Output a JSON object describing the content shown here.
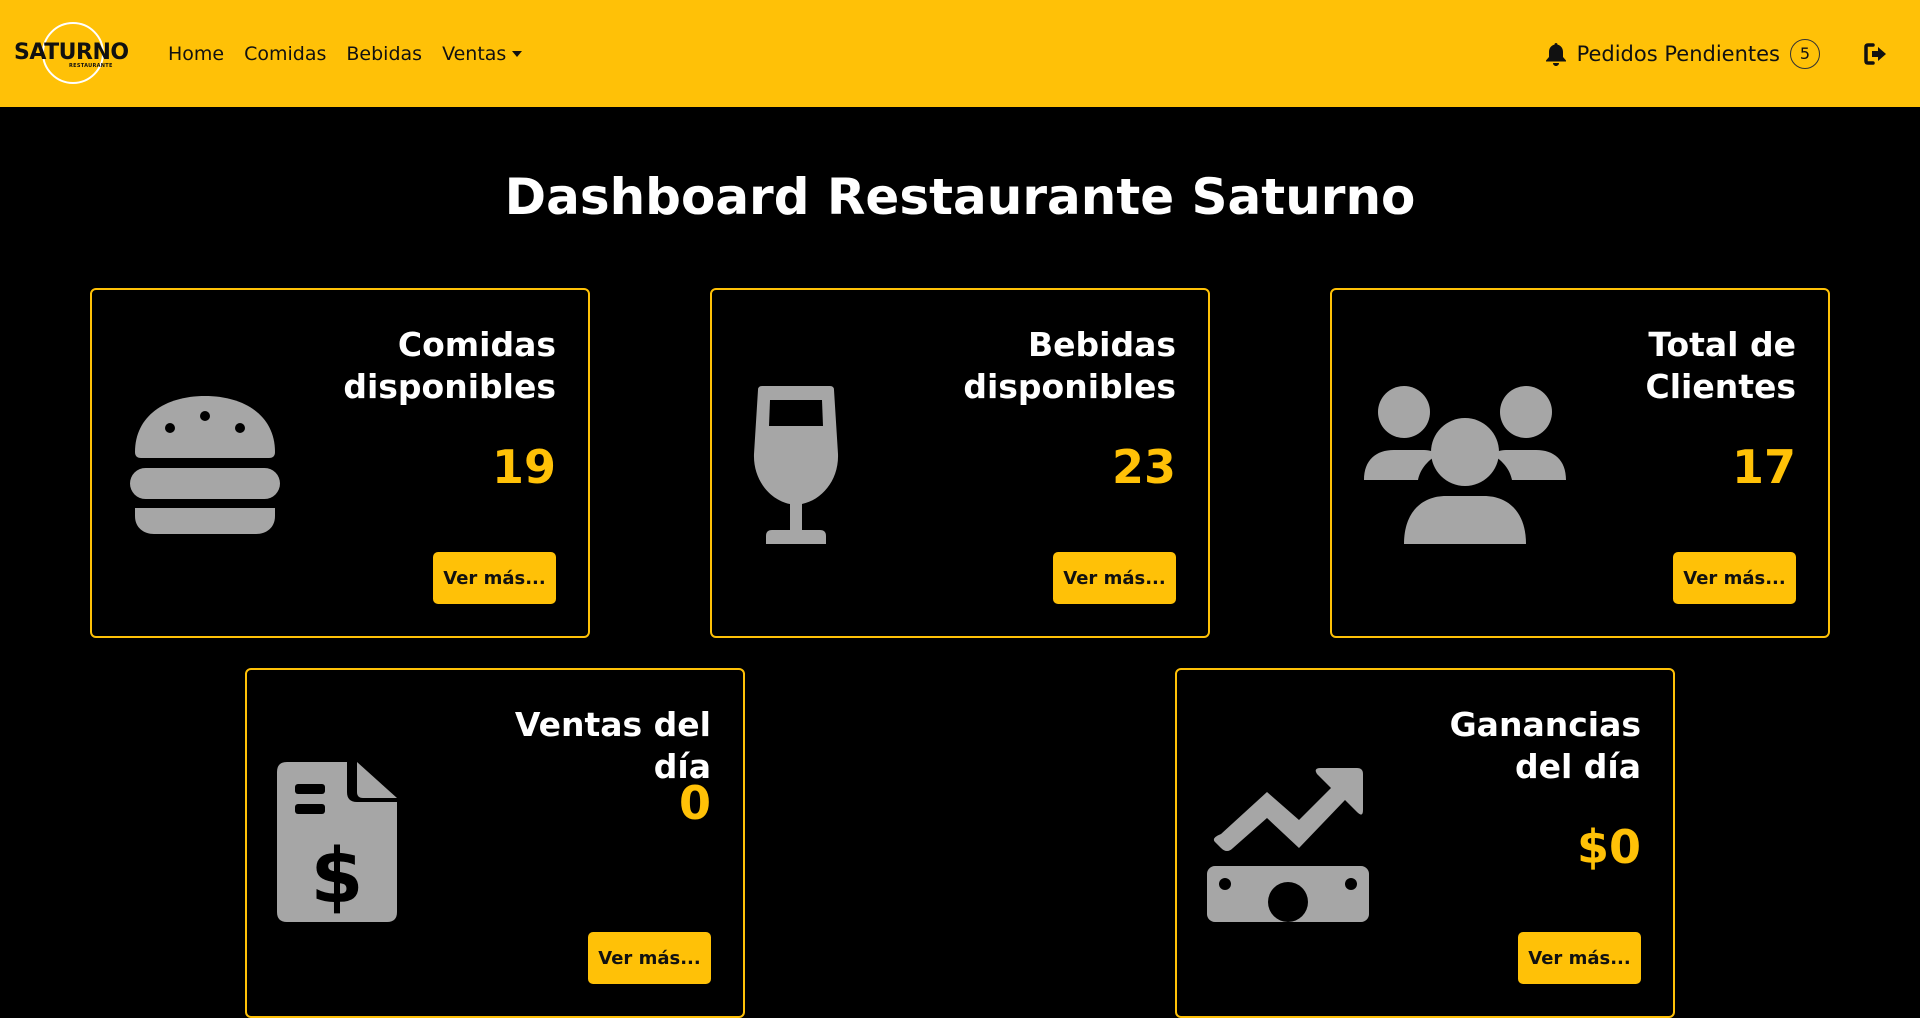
{
  "brand": {
    "name": "SATURNO",
    "sub": "RESTAURANTE"
  },
  "nav": {
    "links": [
      "Home",
      "Comidas",
      "Bebidas",
      "Ventas"
    ],
    "pending_label": "Pedidos Pendientes",
    "pending_count": "5"
  },
  "page_title": "Dashboard Restaurante Saturno",
  "cards": [
    {
      "label": "Comidas disponibles",
      "value": "19",
      "button": "Ver más...",
      "icon": "hamburger-icon"
    },
    {
      "label": "Bebidas disponibles",
      "value": "23",
      "button": "Ver más...",
      "icon": "wine-glass-icon"
    },
    {
      "label": "Total de Clientes",
      "value": "17",
      "button": "Ver más...",
      "icon": "users-icon"
    },
    {
      "label": "Ventas del día",
      "value": "0",
      "button": "Ver más...",
      "icon": "invoice-dollar-icon"
    },
    {
      "label": "Ganancias del día",
      "value": "$0",
      "button": "Ver más...",
      "icon": "money-trend-icon"
    }
  ],
  "colors": {
    "accent": "#ffc107",
    "background": "#000000",
    "icon_gray": "#a6a6a6"
  }
}
